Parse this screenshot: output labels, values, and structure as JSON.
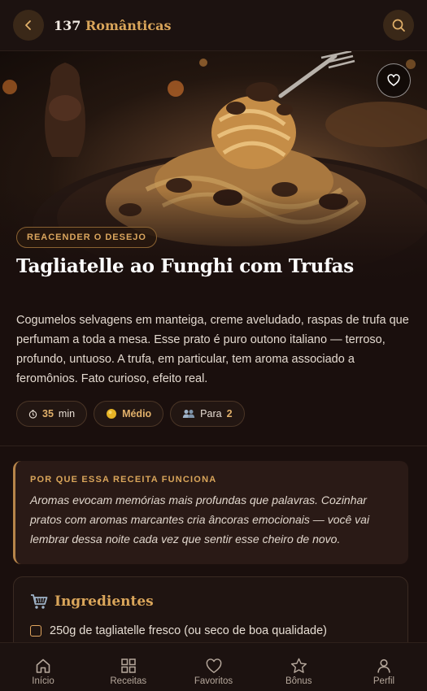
{
  "header": {
    "count": "137",
    "title": "Românticas",
    "back_icon": "chevron-left-icon",
    "search_icon": "search-icon"
  },
  "recipe": {
    "tag": "REACENDER O DESEJO",
    "title": "Tagliatelle ao Funghi com Trufas",
    "description": "Cogumelos selvagens em manteiga, creme aveludado, raspas de trufa que perfumam a toda a mesa. Esse prato é puro outono italiano — terroso, profundo, untuoso. A trufa, em particular, tem aroma associado a feromônios. Fato curioso, efeito real.",
    "chips": {
      "time_value": "35",
      "time_unit": "min",
      "difficulty": "Médio",
      "serves_label": "Para",
      "serves_value": "2"
    }
  },
  "why": {
    "heading": "POR QUE ESSA RECEITA FUNCIONA",
    "body": "Aromas evocam memórias mais profundas que palavras. Cozinhar pratos com aromas marcantes cria âncoras emocionais — você vai lembrar dessa noite cada vez que sentir esse cheiro de novo."
  },
  "ingredients": {
    "heading": "Ingredientes",
    "items": [
      "250g de tagliatelle fresco (ou seco de boa qualidade)"
    ]
  },
  "nav": [
    {
      "label": "Início",
      "icon": "home-icon"
    },
    {
      "label": "Receitas",
      "icon": "grid-icon"
    },
    {
      "label": "Favoritos",
      "icon": "heart-icon"
    },
    {
      "label": "Bônus",
      "icon": "star-icon"
    },
    {
      "label": "Perfil",
      "icon": "user-icon"
    }
  ],
  "colors": {
    "accent": "#d9a55a",
    "background": "#1a0f0d",
    "card": "#2a1a16"
  }
}
